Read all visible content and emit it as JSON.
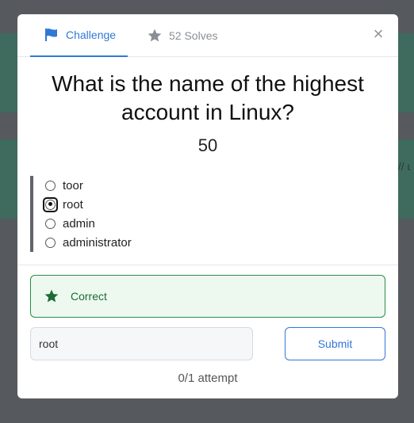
{
  "modal": {
    "tabs": {
      "challenge_label": "Challenge",
      "solves_label": "52 Solves",
      "close_glyph": "×"
    },
    "question": "What is the name of the highest account in Linux?",
    "points": "50",
    "options": [
      {
        "label": "toor",
        "selected": false
      },
      {
        "label": "root",
        "selected": true
      },
      {
        "label": "admin",
        "selected": false
      },
      {
        "label": "administrator",
        "selected": false
      }
    ],
    "alert": {
      "text": "Correct",
      "icon": "star-icon",
      "color": "#1d6b36"
    },
    "answer_value": "root",
    "submit_label": "Submit",
    "attempts": "0/1 attempt"
  },
  "background": {
    "edge_text": "[// u"
  },
  "colors": {
    "accent": "#3178d6",
    "success": "#1d6b36",
    "success_bg": "#edf9ee",
    "overlay": "#56595d"
  }
}
